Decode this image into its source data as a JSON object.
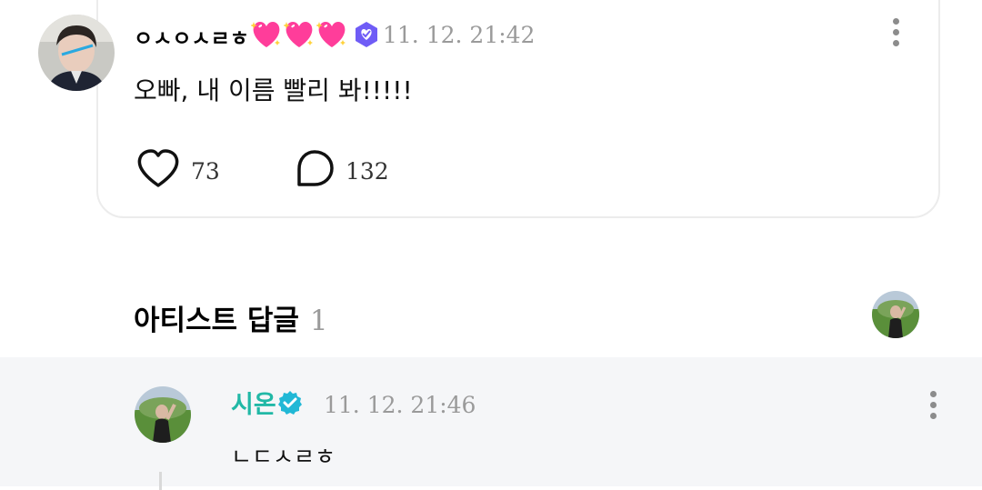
{
  "post": {
    "author": "ㅇㅅㅇㅅㄹㅎ",
    "heart_emoji": "sparkling-heart-emoji",
    "heart_count_shown": 3,
    "badge_icon": "purple-verified-badge-icon",
    "timestamp": "11. 12. 21:42",
    "text": "오빠, 내 이름 빨리 봐!!!!!",
    "likes": "73",
    "comments": "132"
  },
  "artist_replies": {
    "title": "아티스트 답글",
    "count": "1"
  },
  "reply": {
    "author": "시온",
    "badge_icon": "teal-verified-badge-icon",
    "timestamp": "11. 12. 21:46",
    "text": "ㄴㄷㅅㄹㅎ"
  },
  "colors": {
    "artist_name": "#21b8a6",
    "timestamp": "#9a9a9a",
    "reply_background": "#f5f6f8",
    "card_border": "#ececec",
    "badge_purple": "#6f5cf6",
    "heart_pink": "#ff3d9a"
  }
}
